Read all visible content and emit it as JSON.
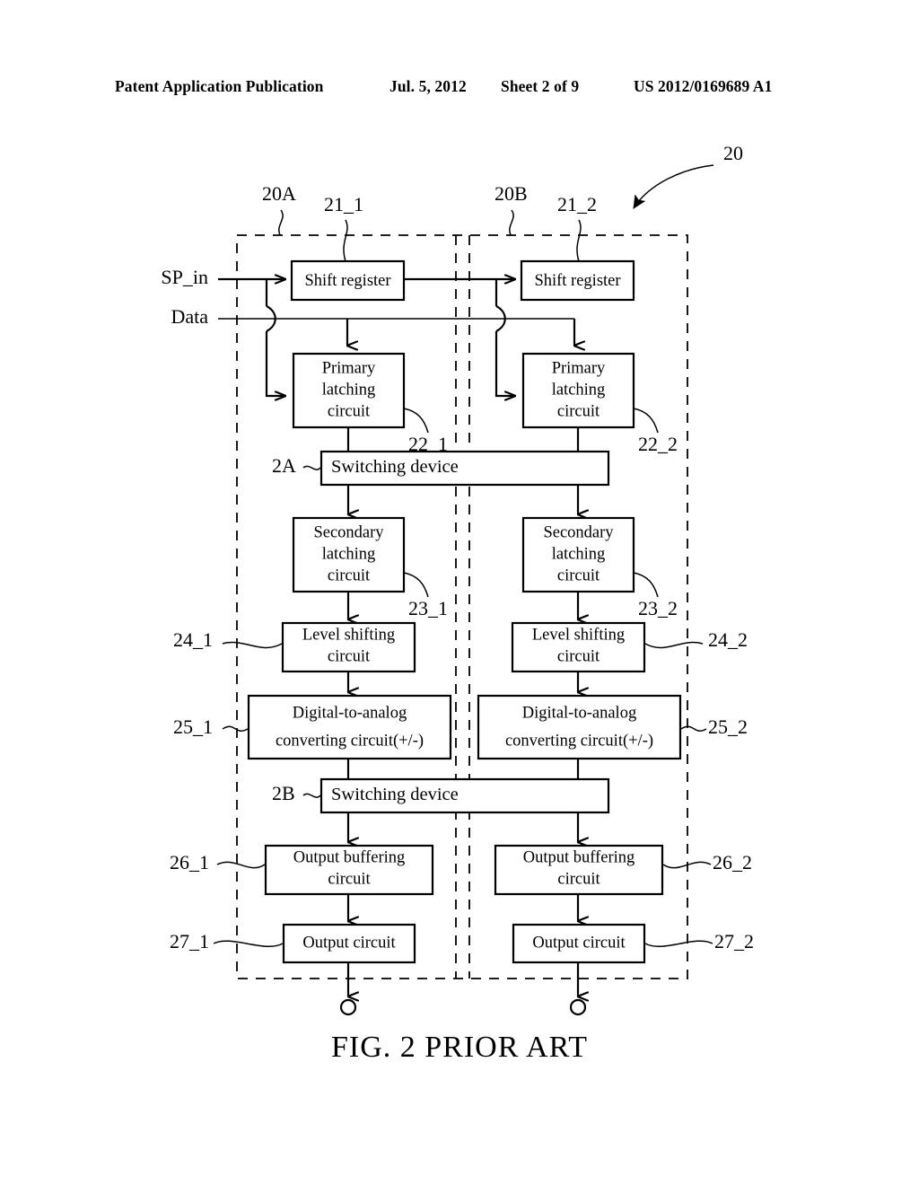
{
  "header": {
    "publication": "Patent Application Publication",
    "date": "Jul. 5, 2012",
    "sheet": "Sheet 2 of 9",
    "number": "US 2012/0169689 A1"
  },
  "figure": {
    "caption": "FIG. 2 PRIOR ART",
    "overall_ref": "20",
    "group_left_ref": "20A",
    "group_right_ref": "20B"
  },
  "inputs": {
    "sp_in": "SP_in",
    "data": "Data"
  },
  "blocks": {
    "shift_register_1": {
      "label": "Shift register",
      "ref": "21_1"
    },
    "shift_register_2": {
      "label": "Shift register",
      "ref": "21_2"
    },
    "primary_latching_1": {
      "line1": "Primary",
      "line2": "latching",
      "line3": "circuit",
      "ref": "22_1"
    },
    "primary_latching_2": {
      "line1": "Primary",
      "line2": "latching",
      "line3": "circuit",
      "ref": "22_2"
    },
    "switching_device_a": {
      "label": "Switching device",
      "ref": "2A"
    },
    "secondary_latching_1": {
      "line1": "Secondary",
      "line2": "latching",
      "line3": "circuit",
      "ref": "23_1"
    },
    "secondary_latching_2": {
      "line1": "Secondary",
      "line2": "latching",
      "line3": "circuit",
      "ref": "23_2"
    },
    "level_shifting_1": {
      "line1": "Level shifting",
      "line2": "circuit",
      "ref": "24_1"
    },
    "level_shifting_2": {
      "line1": "Level shifting",
      "line2": "circuit",
      "ref": "24_2"
    },
    "dac_1": {
      "line1": "Digital-to-analog",
      "line2": "converting circuit(+/-)",
      "ref": "25_1"
    },
    "dac_2": {
      "line1": "Digital-to-analog",
      "line2": "converting circuit(+/-)",
      "ref": "25_2"
    },
    "switching_device_b": {
      "label": "Switching device",
      "ref": "2B"
    },
    "output_buffering_1": {
      "line1": "Output buffering",
      "line2": "circuit",
      "ref": "26_1"
    },
    "output_buffering_2": {
      "line1": "Output buffering",
      "line2": "circuit",
      "ref": "26_2"
    },
    "output_circuit_1": {
      "label": "Output circuit",
      "ref": "27_1"
    },
    "output_circuit_2": {
      "label": "Output circuit",
      "ref": "27_2"
    }
  },
  "colors": {
    "ink": "#000000",
    "paper": "#ffffff"
  }
}
